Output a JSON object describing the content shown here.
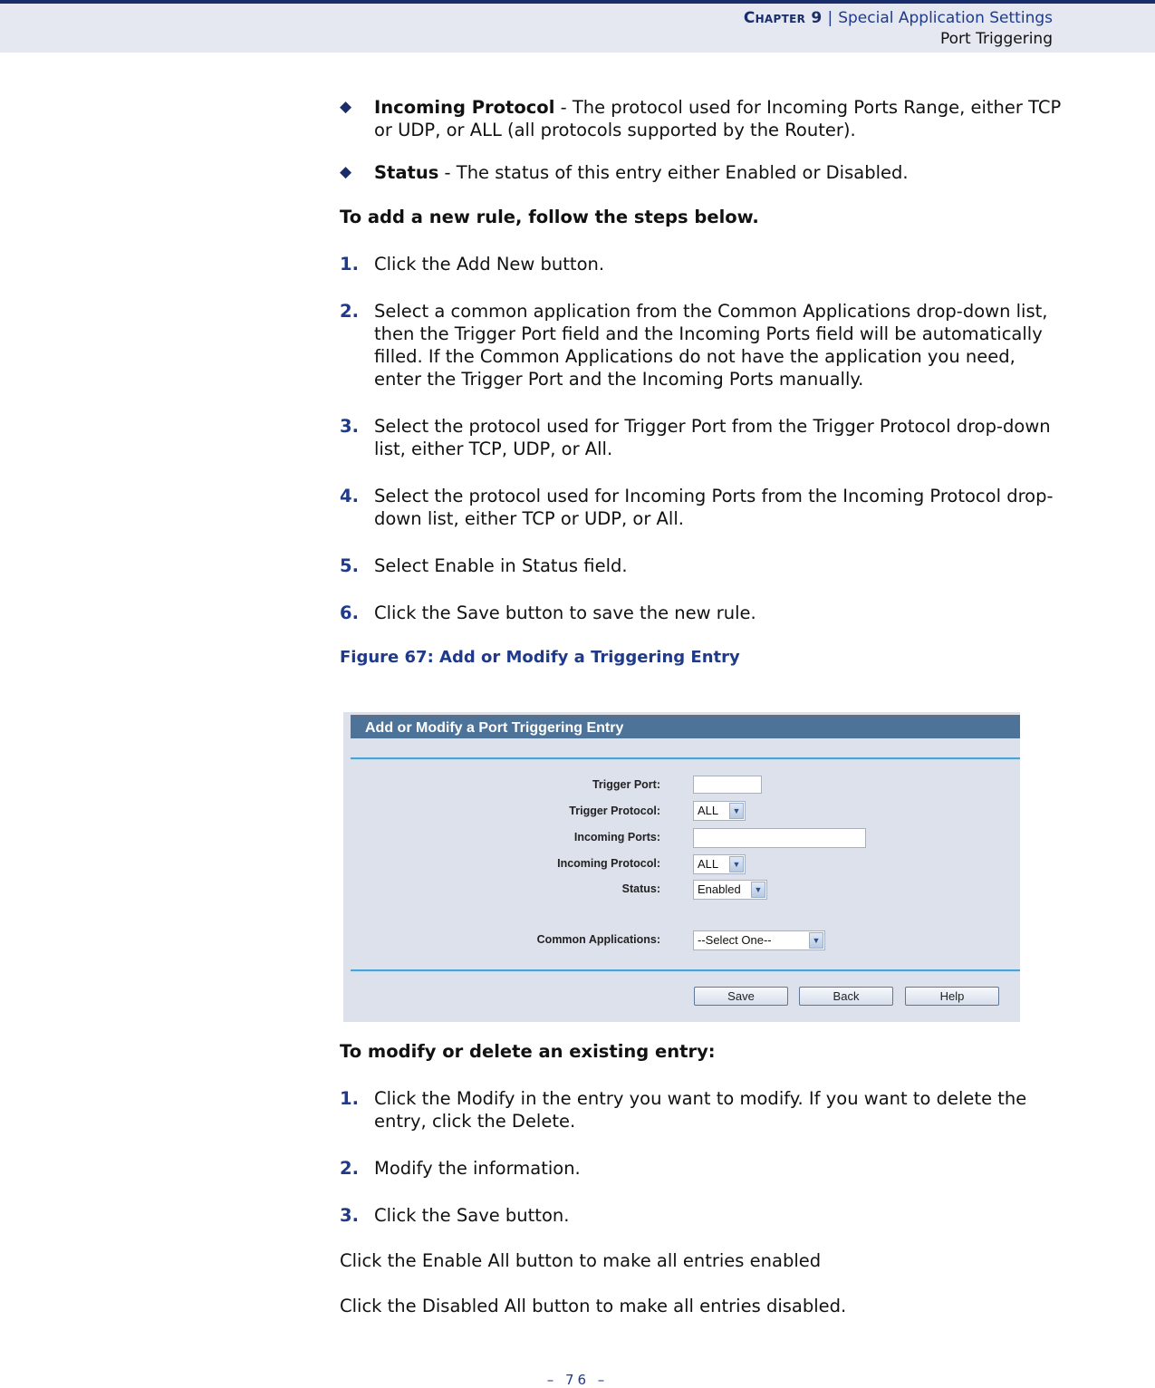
{
  "header": {
    "chapter": "Chapter 9",
    "separator": "|",
    "section": "Special Application Settings",
    "subsection": "Port Triggering"
  },
  "bullets": [
    {
      "term": "Incoming Protocol",
      "text": " - The protocol used for Incoming Ports Range, either TCP or UDP, or ALL (all protocols supported by the Router)."
    },
    {
      "term": "Status",
      "text": " - The status of this entry either Enabled or Disabled."
    }
  ],
  "add_rule": {
    "heading": "To add a new rule, follow the steps below.",
    "steps": [
      {
        "num": "1.",
        "text": "Click the Add New button."
      },
      {
        "num": "2.",
        "text": "Select a common application from the Common Applications drop-down list, then the Trigger Port field and the Incoming Ports field will be automatically filled. If the Common Applications do not have the application you need, enter the Trigger Port and the Incoming Ports manually."
      },
      {
        "num": "3.",
        "text": "Select the protocol used for Trigger Port from the Trigger Protocol drop-down list, either TCP, UDP, or All."
      },
      {
        "num": "4.",
        "text": "Select the protocol used for Incoming Ports from the Incoming Protocol drop-down list, either TCP or UDP, or All."
      },
      {
        "num": "5.",
        "text": "Select Enable in Status field."
      },
      {
        "num": "6.",
        "text": "Click the Save button to save the new rule."
      }
    ]
  },
  "figure": {
    "caption": "Figure 67:  Add or Modify a Triggering Entry",
    "title": "Add or Modify a Port Triggering Entry",
    "fields": {
      "trigger_port": {
        "label": "Trigger Port:",
        "value": ""
      },
      "trigger_protocol": {
        "label": "Trigger Protocol:",
        "value": "ALL"
      },
      "incoming_ports": {
        "label": "Incoming Ports:",
        "value": ""
      },
      "incoming_protocol": {
        "label": "Incoming Protocol:",
        "value": "ALL"
      },
      "status": {
        "label": "Status:",
        "value": "Enabled"
      },
      "common_applications": {
        "label": "Common Applications:",
        "value": "--Select One--"
      }
    },
    "buttons": {
      "save": "Save",
      "back": "Back",
      "help": "Help"
    },
    "colors": {
      "title_bar": "#4e7398",
      "panel": "#dce1ec",
      "divider": "#4aa3d4"
    }
  },
  "modify": {
    "heading": "To modify or delete an existing entry:",
    "steps": [
      {
        "num": "1.",
        "text": "Click the Modify in the entry you want to modify. If you want to delete the entry, click the Delete."
      },
      {
        "num": "2.",
        "text": "Modify the information."
      },
      {
        "num": "3.",
        "text": "Click the Save button."
      }
    ]
  },
  "notes": [
    "Click the Enable All button to make all entries enabled",
    "Click the Disabled All button to make all entries disabled."
  ],
  "footer": {
    "page": "– 76 –"
  }
}
